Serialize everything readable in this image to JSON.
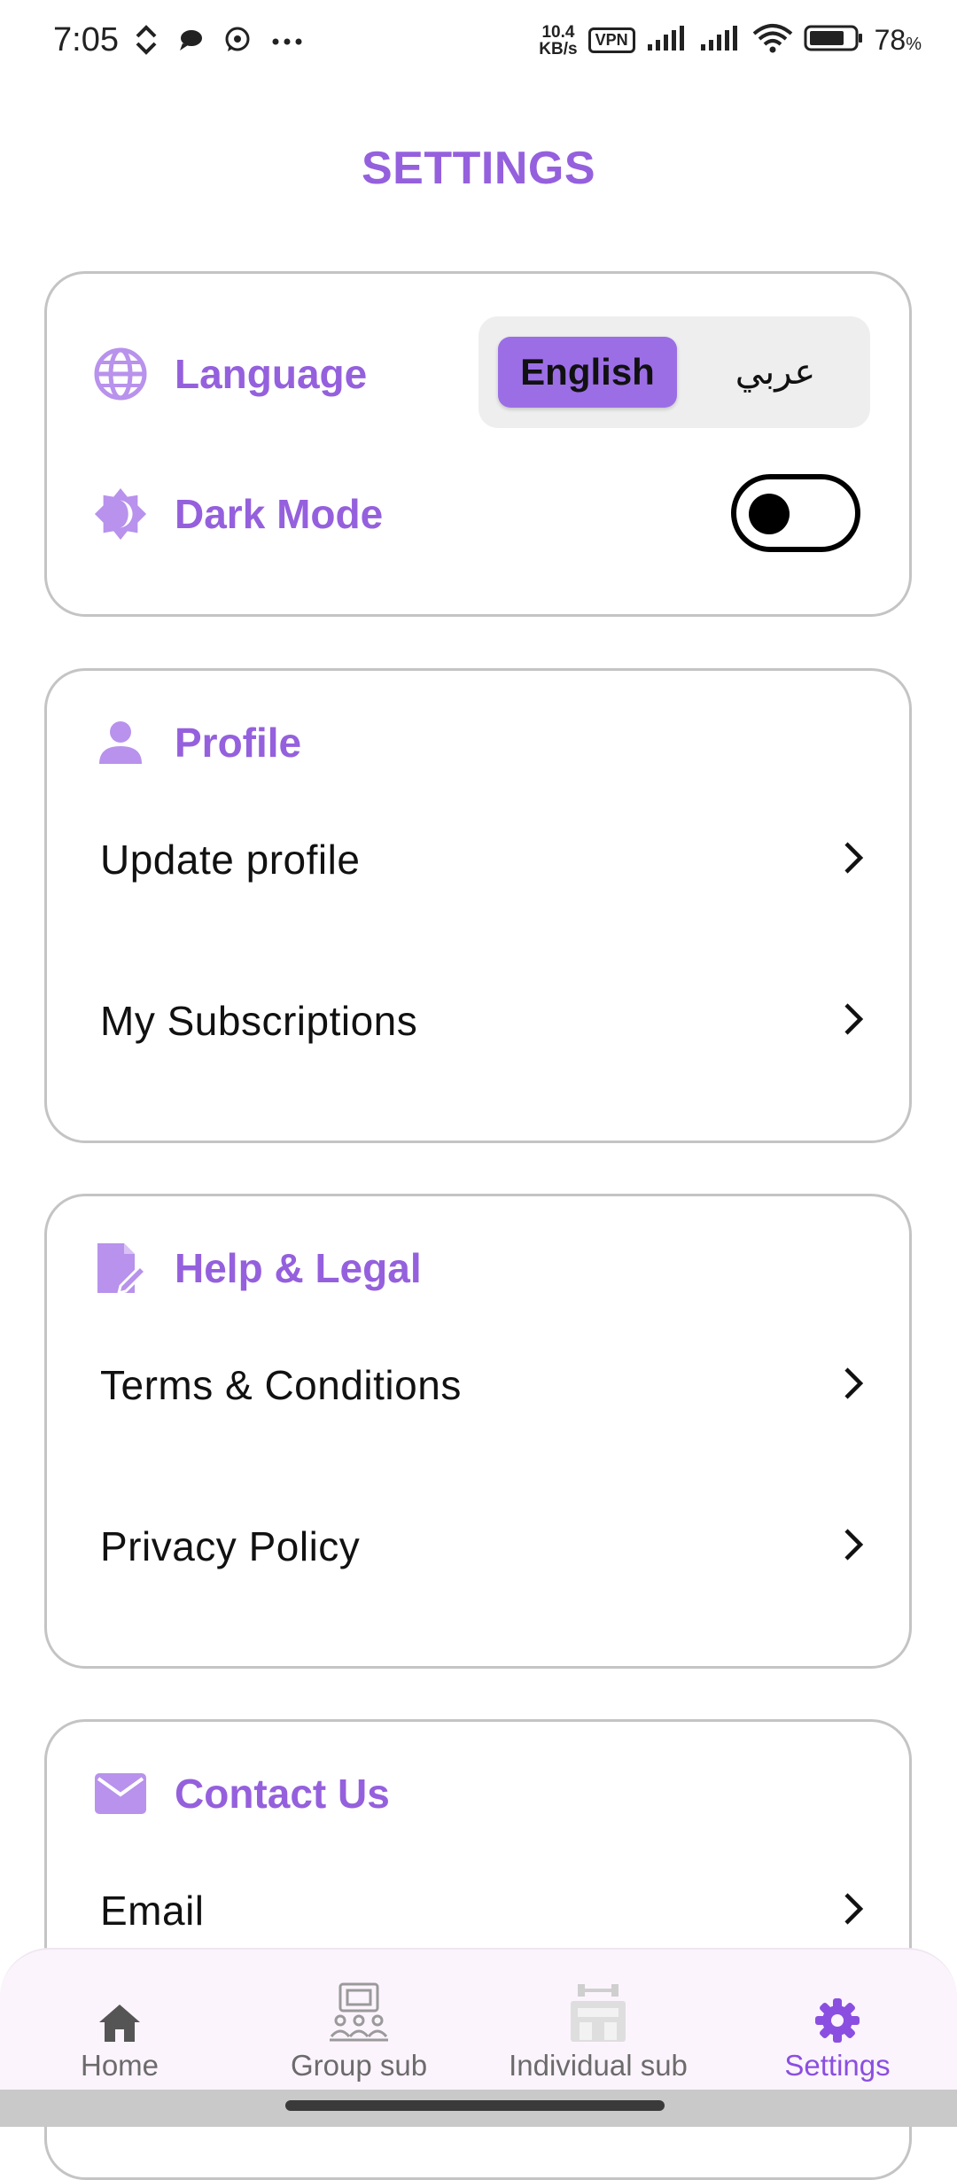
{
  "status_bar": {
    "time": "7:05",
    "net_speed_value": "10.4",
    "net_speed_unit": "KB/s",
    "vpn": "VPN",
    "battery_percent": "78",
    "battery_unit": "%"
  },
  "page": {
    "title": "SETTINGS"
  },
  "preferences": {
    "language_label": "Language",
    "language_options": [
      "English",
      "عربي"
    ],
    "language_selected": "English",
    "dark_mode_label": "Dark Mode",
    "dark_mode_on": false
  },
  "profile": {
    "heading": "Profile",
    "items": [
      {
        "label": "Update profile"
      },
      {
        "label": "My Subscriptions"
      }
    ]
  },
  "help_legal": {
    "heading": "Help & Legal",
    "items": [
      {
        "label": "Terms & Conditions"
      },
      {
        "label": "Privacy Policy"
      }
    ]
  },
  "contact": {
    "heading": "Contact Us",
    "items": [
      {
        "label": "Email"
      }
    ]
  },
  "bottom_nav": {
    "items": [
      {
        "label": "Home",
        "icon": "home-icon"
      },
      {
        "label": "Group sub",
        "icon": "group-sub-icon"
      },
      {
        "label": "Individual sub",
        "icon": "individual-sub-icon"
      },
      {
        "label": "Settings",
        "icon": "gear-icon"
      }
    ],
    "active": "Settings"
  },
  "colors": {
    "accent": "#9560dd",
    "accent_light": "#b892ec",
    "toggle_selected_bg": "#9c6ee6",
    "nav_bg": "#fcf4fc"
  }
}
